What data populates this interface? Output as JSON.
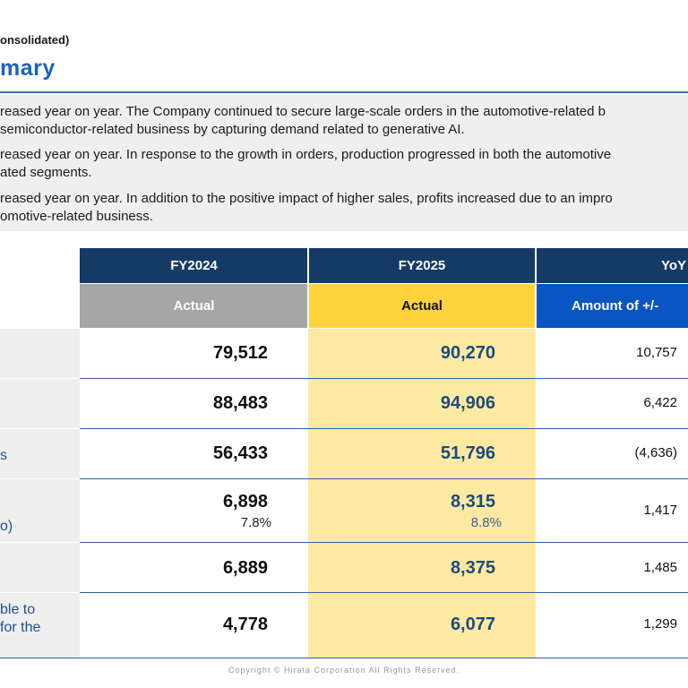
{
  "header": {
    "subtitle": "onsolidated)",
    "title": "mary"
  },
  "summary": {
    "paragraphs": [
      {
        "lines": [
          "reased year on year. The Company continued to secure large-scale orders in the automotive-related b",
          " semiconductor-related business by capturing demand related to generative AI."
        ]
      },
      {
        "lines": [
          "reased year on year. In response to the growth in orders, production progressed in both the automotive",
          "ated segments."
        ]
      },
      {
        "lines": [
          "reased year on year. In addition to the positive impact of higher sales, profits increased due to an impro",
          "omotive-related business."
        ]
      }
    ]
  },
  "table": {
    "col_headers": {
      "fy2024": "FY2024",
      "fy2025": "FY2025",
      "yoy": "YoY"
    },
    "sub_headers": {
      "fy2024": "Actual",
      "fy2025": "Actual",
      "yoy": "Amount of +/-"
    },
    "colors": {
      "header_navy": "#163a66",
      "actual_gray": "#a6a6a6",
      "actual_yellow": "#fdd23a",
      "yoy_blue": "#0a55c4",
      "highlight_yellow": "#fde9a2"
    },
    "rows": [
      {
        "label_lines": [],
        "fy2024": "79,512",
        "fy2025": "90,270",
        "yoy": "10,757"
      },
      {
        "label_lines": [],
        "fy2024": "88,483",
        "fy2025": "94,906",
        "yoy": "6,422"
      },
      {
        "label_lines": [
          "s"
        ],
        "fy2024": "56,433",
        "fy2025": "51,796",
        "yoy": "(4,636)"
      },
      {
        "label_lines": [
          "o)"
        ],
        "fy2024": "6,898",
        "fy2024_pct": "7.8%",
        "fy2025": "8,315",
        "fy2025_pct": "8.8%",
        "yoy": "1,417"
      },
      {
        "label_lines": [],
        "fy2024": "6,889",
        "fy2025": "8,375",
        "yoy": "1,485"
      },
      {
        "label_lines": [
          "ble to",
          " for the"
        ],
        "fy2024": "4,778",
        "fy2025": "6,077",
        "yoy": "1,299"
      }
    ]
  },
  "footer": {
    "copyright": "Copyright © Hirata Corporation All Rights Reserved."
  }
}
